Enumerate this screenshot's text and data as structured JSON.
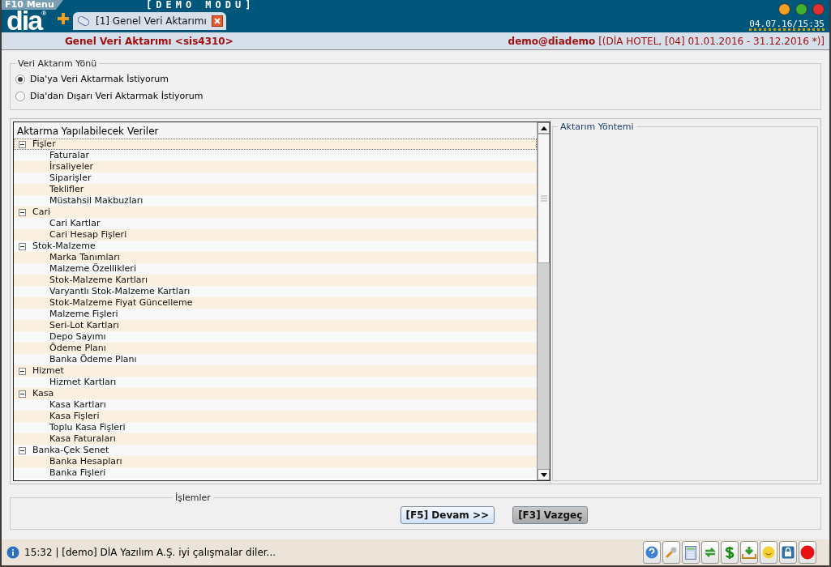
{
  "menu_button": "F10 Menu",
  "mode_banner": "[DEMO   MODU]",
  "logo": {
    "text": "dia",
    "mark": "®"
  },
  "tab": {
    "label": "[1] Genel Veri Aktarımı",
    "selected": true
  },
  "clock": "04.07.16/15:35",
  "header": {
    "title": "Genel Veri Aktarımı <sis4310>",
    "user": "demo@diademo",
    "context": "[(DİA HOTEL, [04] 01.01.2016 - 31.12.2016 *)]"
  },
  "direction": {
    "legend": "Veri Aktarım Yönü",
    "options": [
      {
        "label": "Dia'ya Veri Aktarmak İstiyorum",
        "selected": true
      },
      {
        "label": "Dia'dan Dışarı Veri Aktarmak İstiyorum",
        "selected": false
      }
    ]
  },
  "tree": {
    "heading": "Aktarma Yapılabilecek Veriler",
    "items": [
      {
        "label": "Fişler",
        "expanded": true,
        "selected": true,
        "children": [
          {
            "label": "Faturalar"
          },
          {
            "label": "İrsaliyeler"
          },
          {
            "label": "Siparişler"
          },
          {
            "label": "Teklifler"
          },
          {
            "label": "Müstahsil Makbuzları"
          }
        ]
      },
      {
        "label": "Cari",
        "expanded": true,
        "selected": false,
        "children": [
          {
            "label": "Cari Kartlar"
          },
          {
            "label": "Cari Hesap Fişleri"
          }
        ]
      },
      {
        "label": "Stok-Malzeme",
        "expanded": true,
        "selected": false,
        "children": [
          {
            "label": "Marka Tanımları"
          },
          {
            "label": "Malzeme Özellikleri"
          },
          {
            "label": "Stok-Malzeme Kartları"
          },
          {
            "label": "Varyantlı Stok-Malzeme Kartları"
          },
          {
            "label": "Stok-Malzeme Fiyat Güncelleme"
          },
          {
            "label": "Malzeme Fişleri"
          },
          {
            "label": "Seri-Lot Kartları"
          },
          {
            "label": "Depo Sayımı"
          },
          {
            "label": "Ödeme Planı"
          },
          {
            "label": "Banka Ödeme Planı"
          }
        ]
      },
      {
        "label": "Hizmet",
        "expanded": true,
        "selected": false,
        "children": [
          {
            "label": "Hizmet Kartları"
          }
        ]
      },
      {
        "label": "Kasa",
        "expanded": true,
        "selected": false,
        "children": [
          {
            "label": "Kasa Kartları"
          },
          {
            "label": "Kasa Fişleri"
          },
          {
            "label": "Toplu Kasa Fişleri"
          },
          {
            "label": "Kasa Faturaları"
          }
        ]
      },
      {
        "label": "Banka-Çek Senet",
        "expanded": true,
        "selected": false,
        "children": [
          {
            "label": "Banka Hesapları"
          },
          {
            "label": "Banka Fişleri"
          }
        ]
      }
    ]
  },
  "method": {
    "legend": "Aktarım Yöntemi"
  },
  "actions": {
    "legend": "İşlemler",
    "buttons": [
      {
        "label": "[F5] Devam >>",
        "kind": "primary"
      },
      {
        "label": "[F3] Vazgeç",
        "kind": "secondary"
      }
    ]
  },
  "status": {
    "message": "15:32 | [demo] DİA Yazılım A.Ş. iyi çalışmalar diler..."
  },
  "tray": [
    {
      "kind": "help"
    },
    {
      "kind": "wrench"
    },
    {
      "kind": "calculator"
    },
    {
      "kind": "sync"
    },
    {
      "kind": "dollar"
    },
    {
      "kind": "download"
    },
    {
      "kind": "smiley"
    },
    {
      "kind": "lock"
    },
    {
      "kind": "stop"
    }
  ]
}
